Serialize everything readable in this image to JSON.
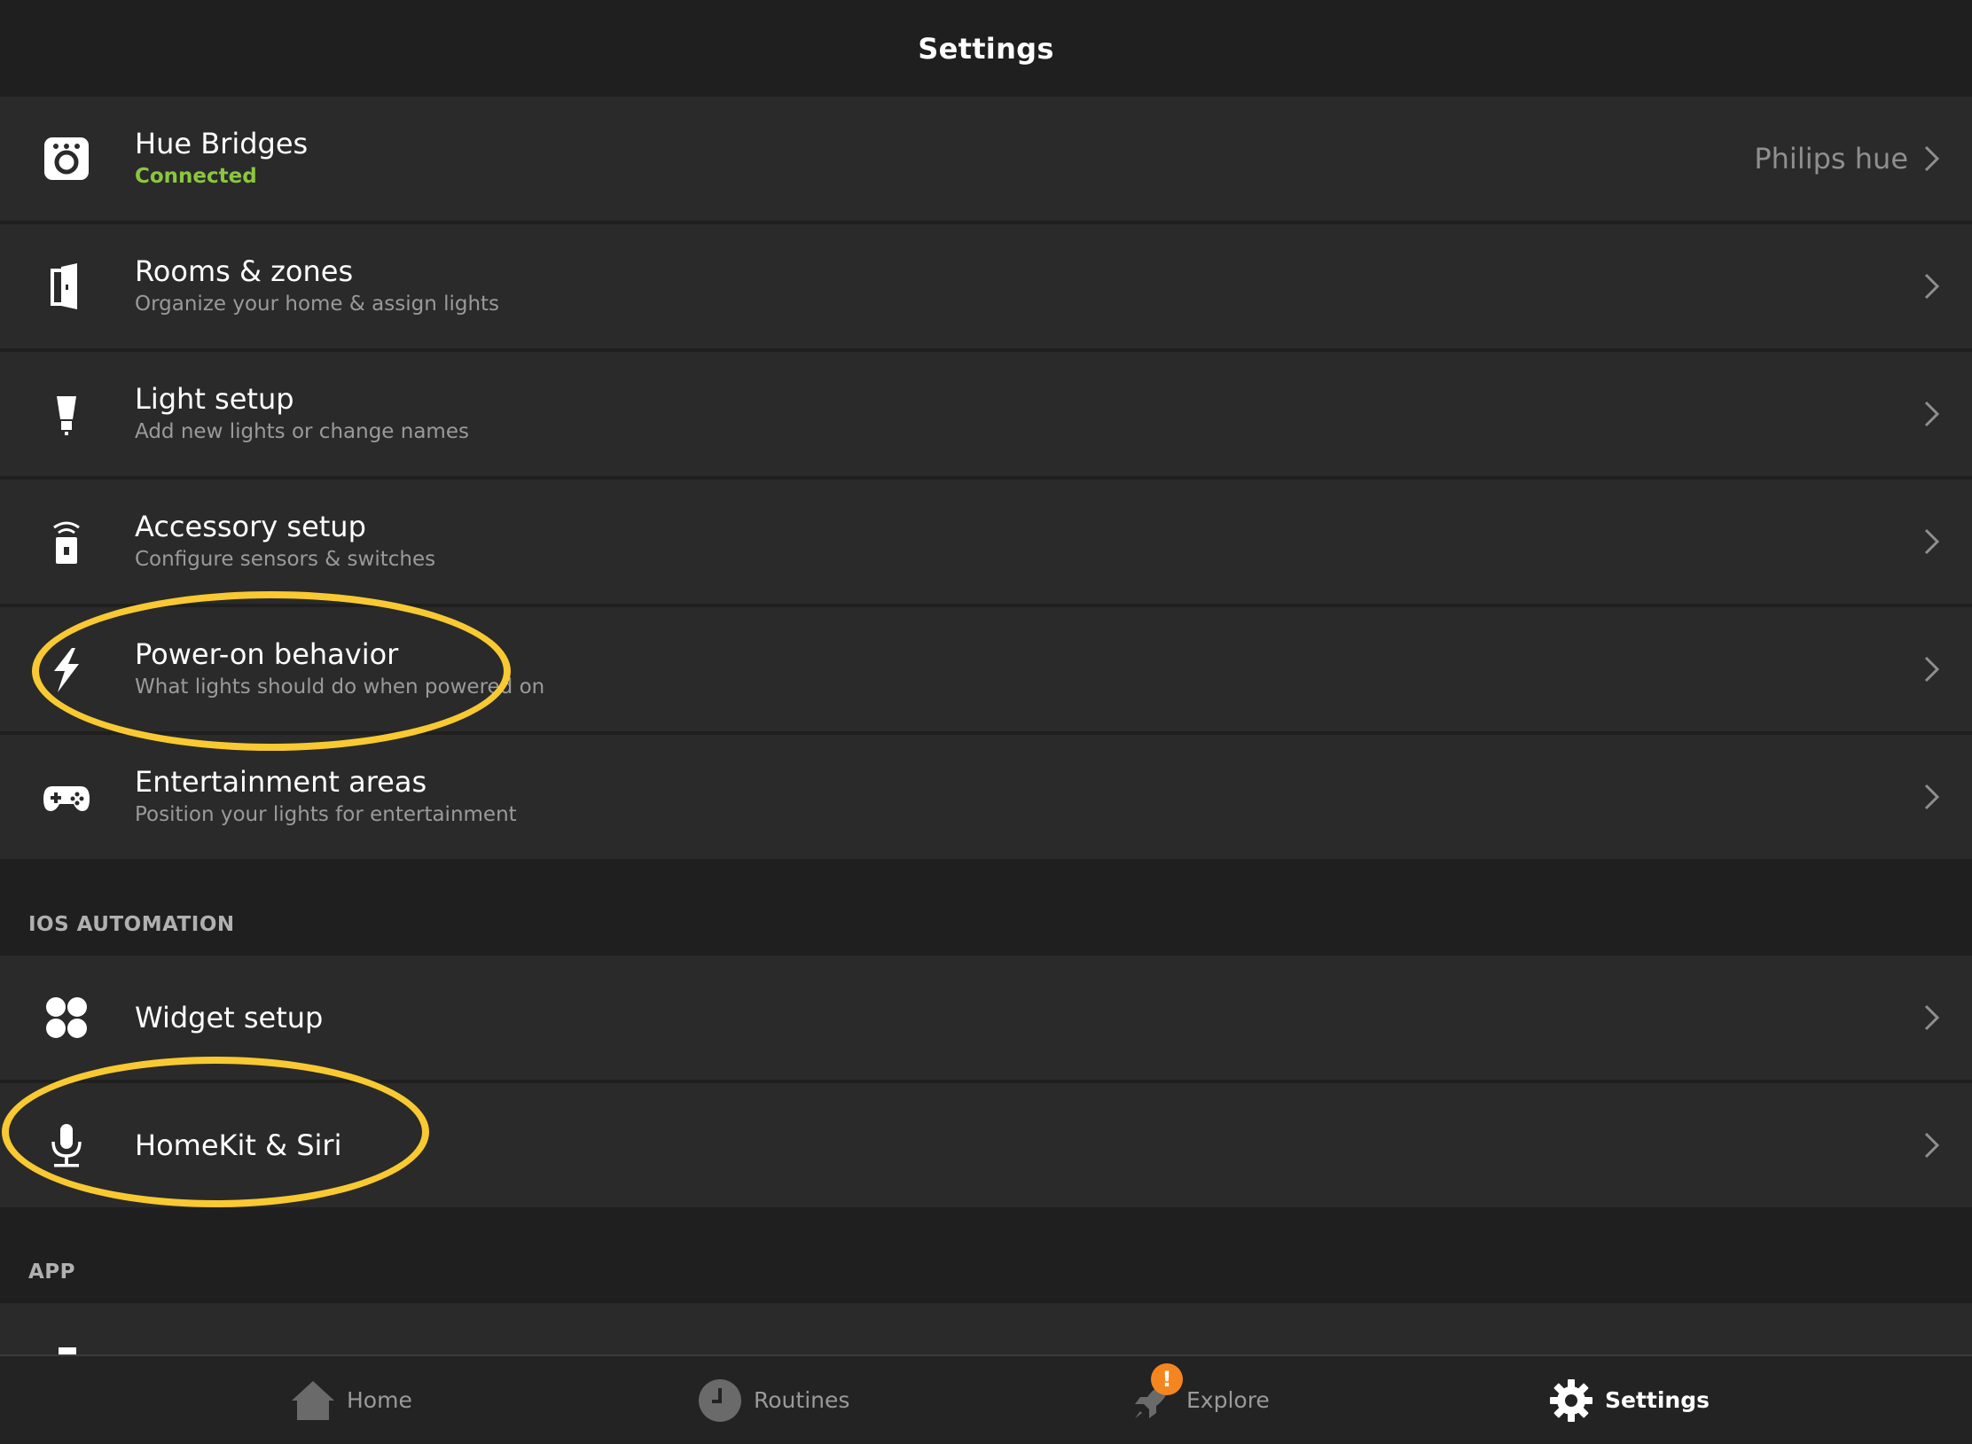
{
  "header": {
    "title": "Settings"
  },
  "rows": [
    {
      "title": "Hue Bridges",
      "subtitle": "Connected",
      "value": "Philips hue",
      "icon": "bridge-icon"
    },
    {
      "title": "Rooms & zones",
      "subtitle": "Organize your home & assign lights",
      "icon": "door-icon"
    },
    {
      "title": "Light setup",
      "subtitle": "Add new lights or change names",
      "icon": "bulb-icon"
    },
    {
      "title": "Accessory setup",
      "subtitle": "Configure sensors & switches",
      "icon": "accessory-icon"
    },
    {
      "title": "Power-on behavior",
      "subtitle": "What lights should do when powered on",
      "icon": "lightning-icon"
    },
    {
      "title": "Entertainment areas",
      "subtitle": "Position your lights for entertainment",
      "icon": "gamepad-icon"
    }
  ],
  "sections": {
    "ios_automation": "IOS AUTOMATION",
    "app": "APP"
  },
  "ios_rows": [
    {
      "title": "Widget setup",
      "icon": "widget-icon"
    },
    {
      "title": "HomeKit & Siri",
      "icon": "microphone-icon"
    }
  ],
  "tabs": [
    {
      "label": "Home",
      "icon": "home-icon",
      "active": false
    },
    {
      "label": "Routines",
      "icon": "clock-icon",
      "active": false
    },
    {
      "label": "Explore",
      "icon": "rocket-icon",
      "active": false,
      "badge": "!"
    },
    {
      "label": "Settings",
      "icon": "gear-icon",
      "active": true
    }
  ],
  "colors": {
    "background": "#1f1f1f",
    "row": "#2a2a2a",
    "connected": "#8cc63f",
    "highlight": "#f9c932",
    "badge": "#f5861f"
  }
}
